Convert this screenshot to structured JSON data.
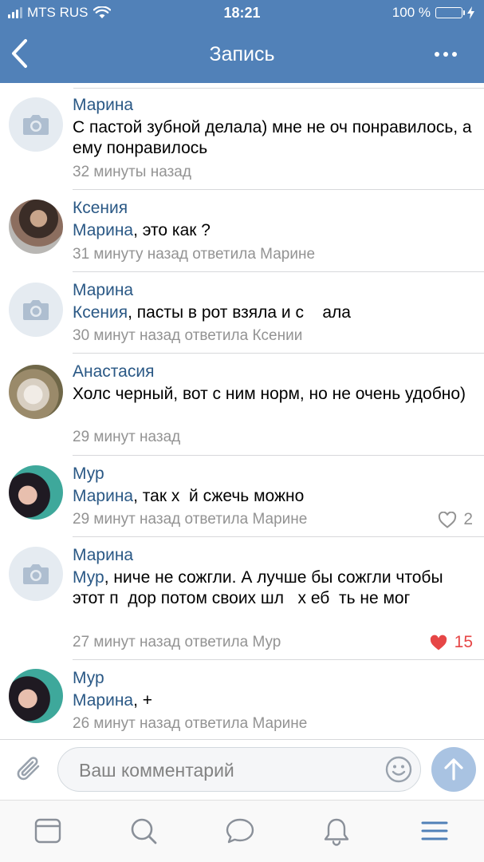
{
  "status_bar": {
    "carrier": "MTS RUS",
    "time": "18:21",
    "battery_text": "100 %"
  },
  "nav": {
    "title": "Запись",
    "back_icon": "chevron-left-icon",
    "more_icon": "more-horizontal-icon"
  },
  "colors": {
    "header_bg": "#5181b8",
    "name_link": "#2a5885",
    "meta_text": "#939393",
    "like_red": "#e64646",
    "send_button": "#a9c3e2"
  },
  "comments": [
    {
      "author": "Марина",
      "reply_to": "",
      "text": "С пастой зубной делала) мне не оч понравилось, а ему понравилось",
      "meta": "32 минуты назад",
      "likes": ""
    },
    {
      "author": "Ксения",
      "reply_to": "Марина",
      "text": ", это как ?",
      "meta": "31 минуту назад ответила Марине",
      "likes": ""
    },
    {
      "author": "Марина",
      "reply_to": "Ксения",
      "text": ", пасты в рот взяла и с    ала",
      "meta": "30 минут назад ответила Ксении",
      "likes": ""
    },
    {
      "author": "Анастасия",
      "reply_to": "",
      "text": "Холс черный, вот с ним норм, но не очень удобно)",
      "meta": "29 минут назад",
      "likes": ""
    },
    {
      "author": "Мур",
      "reply_to": "Марина",
      "text": ", так х  й сжечь можно",
      "meta": "29 минут назад ответила Марине",
      "likes": "2"
    },
    {
      "author": "Марина",
      "reply_to": "Мур",
      "text": ", ниче не сожгли. А лучше бы сожгли чтобы этот п  дор потом своих шл   х еб  ть не мог",
      "meta": "27 минут назад ответила Мур",
      "likes": "15"
    },
    {
      "author": "Мур",
      "reply_to": "Марина",
      "text": ", +",
      "meta": "26 минут назад ответила Марине",
      "likes": ""
    }
  ],
  "composer": {
    "placeholder": "Ваш комментарий",
    "value": ""
  },
  "tab_bar": {
    "items": [
      "newsfeed-icon",
      "search-icon",
      "messages-icon",
      "notifications-icon",
      "menu-icon"
    ]
  }
}
